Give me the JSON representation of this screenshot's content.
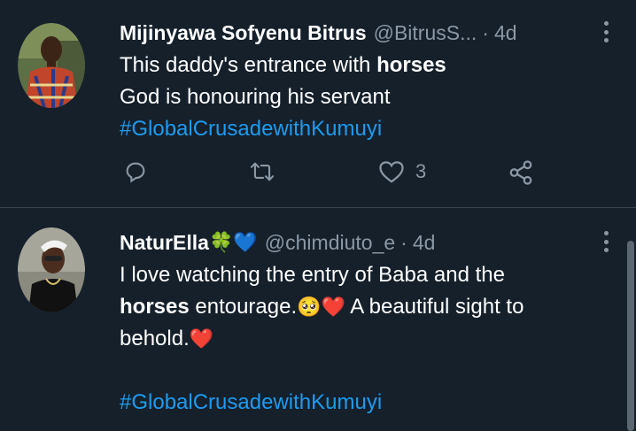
{
  "tweets": [
    {
      "name": "Mijinyawa Sofyenu Bitrus",
      "handle": "@BitrusS...",
      "separator": "·",
      "time": "4d",
      "line1_pre": "This daddy's entrance with ",
      "line1_bold": "horses",
      "line2": "God is honouring his servant",
      "hashtag": "#GlobalCrusadewithKumuyi",
      "actions": {
        "reply_count": "",
        "retweet_count": "",
        "like_count": "3"
      }
    },
    {
      "name": "NaturElla",
      "name_emojis": "🍀💙",
      "handle": "@chimdiuto_e",
      "separator": "·",
      "time": "4d",
      "line1": "I love watching the entry of Baba and the",
      "line2_bold": "horses",
      "line2_rest": " entourage.",
      "line2_emojis": "🥺❤️",
      "line2_tail": " A beautiful sight to",
      "line3": "behold.",
      "line3_emoji": "❤️",
      "hashtag": "#GlobalCrusadewithKumuyi"
    }
  ],
  "colors": {
    "background": "#15202b",
    "link": "#1d9bf0",
    "secondary": "#8b98a5",
    "divider": "#38444d"
  },
  "icons": [
    "reply-icon",
    "retweet-icon",
    "like-icon",
    "share-icon",
    "more-icon"
  ]
}
